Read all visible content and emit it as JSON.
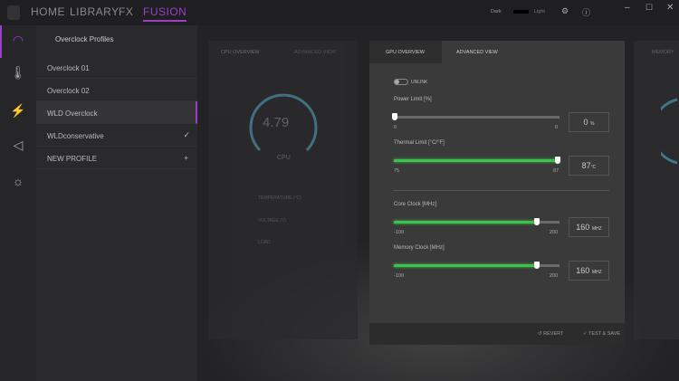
{
  "nav": {
    "items": [
      "HOME",
      "LIBRARY",
      "FX",
      "FUSION"
    ],
    "active": "FUSION"
  },
  "topbar": {
    "theme_dark": "Dark",
    "theme_light": "Light"
  },
  "profiles": {
    "title": "Overclock Profiles",
    "items": [
      "Overclock 01",
      "Overclock 02",
      "WLD Overclock",
      "WLDconservative"
    ],
    "selected": "WLD Overclock",
    "checked": "WLDconservative",
    "new_profile": "NEW PROFILE"
  },
  "cpu": {
    "tab_overview": "CPU OVERVIEW",
    "tab_advanced": "ADVANCED VIEW",
    "gauge_value": "4.79",
    "gauge_label": "CPU",
    "stats": [
      "TEMPERATURE (°C)",
      "VOLTAGE (V)",
      "LOAD"
    ]
  },
  "gpu": {
    "tab_overview": "GPU OVERVIEW",
    "tab_advanced": "ADVANCED VIEW",
    "unlink": "UNLINK",
    "power": {
      "label": "Power Limit [%]",
      "min": "0",
      "max": "0",
      "value": "0",
      "unit": "%",
      "fraction": 0
    },
    "thermal": {
      "label": "Thermal Limit [°C/°F]",
      "min": "75",
      "max": "87",
      "value": "87",
      "unit": "°C",
      "fraction": 1
    },
    "core": {
      "label": "Core Clock [MHz]",
      "min": "-100",
      "max": "200",
      "value": "160",
      "unit": "MHZ",
      "fraction": 0.867
    },
    "memory": {
      "label": "Memory Clock [MHz]",
      "min": "-100",
      "max": "200",
      "value": "160",
      "unit": "MHZ",
      "fraction": 0.867
    }
  },
  "bottom": {
    "revert": "REVERT",
    "save": "TEST & SAVE"
  },
  "right": {
    "tab": "MEMORY"
  },
  "colors": {
    "accent": "#9b3fc7",
    "green": "#3cc24a",
    "gauge": "#4a8aa0"
  }
}
